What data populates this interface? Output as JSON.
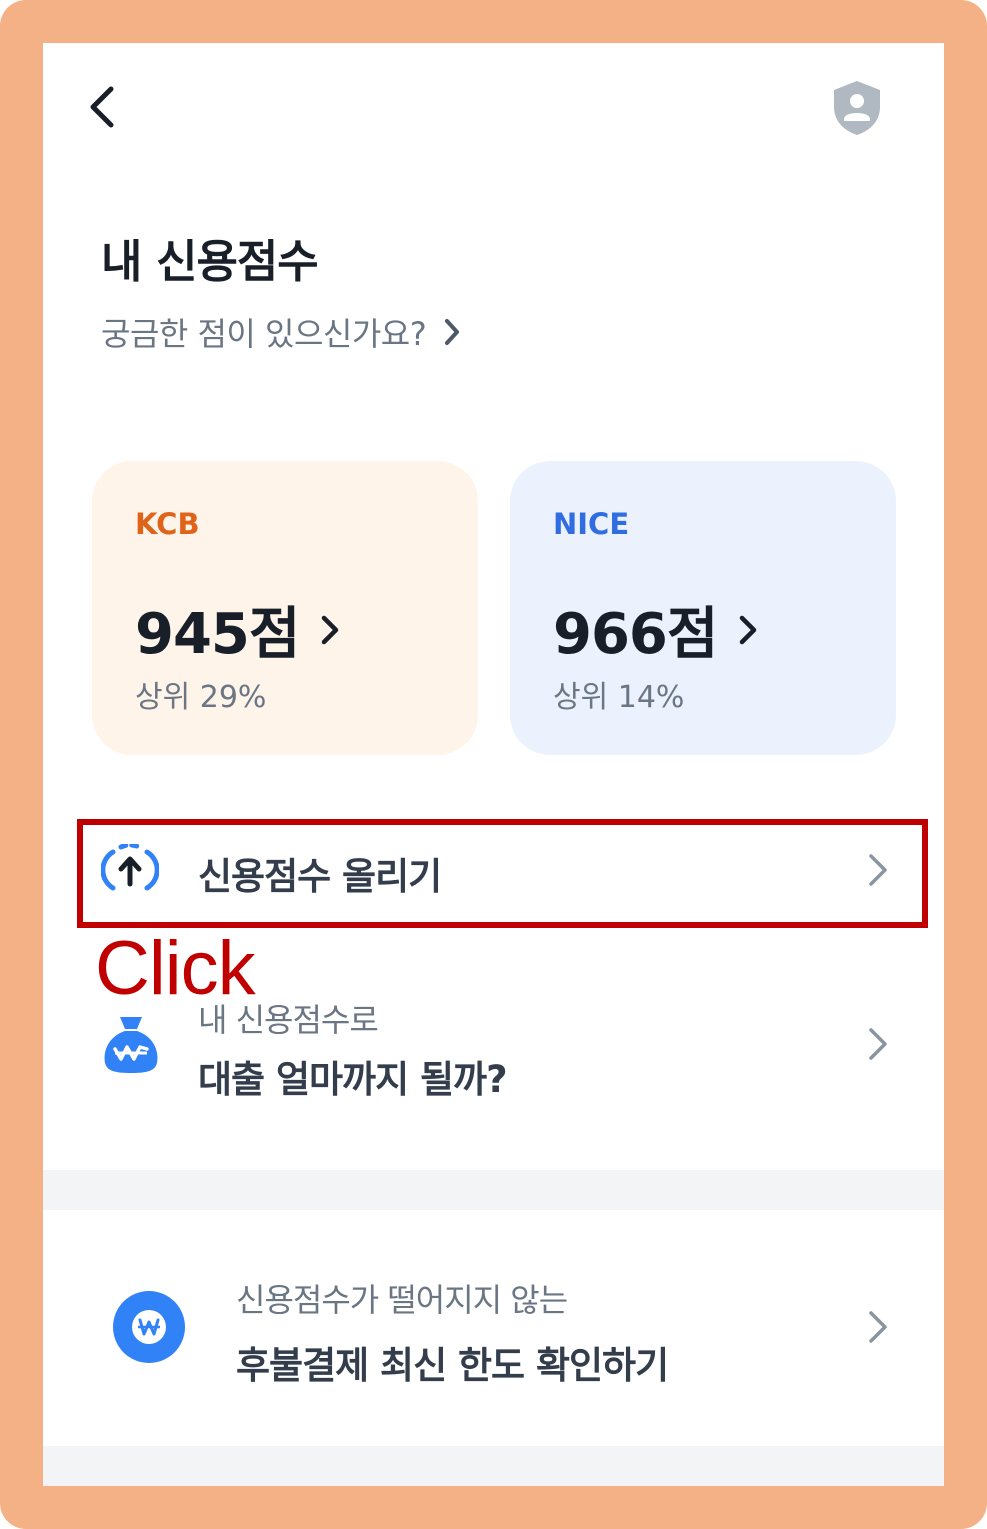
{
  "header": {
    "back_icon": "chevron-left-icon",
    "profile_icon": "shield-user-icon"
  },
  "page": {
    "title": "내 신용점수",
    "help_link": "궁금한 점이 있으신가요?"
  },
  "score_cards": [
    {
      "agency": "KCB",
      "score": "945점",
      "rank": "상위 29%",
      "accent": "#e0631a",
      "background": "#fef4e9"
    },
    {
      "agency": "NICE",
      "score": "966점",
      "rank": "상위 14%",
      "accent": "#2f6de1",
      "background": "#ebf2fe"
    }
  ],
  "menu": {
    "improve_score": {
      "label": "신용점수 올리기",
      "icon": "arrow-up-circle-icon"
    },
    "loan_limit": {
      "subtitle": "내 신용점수로",
      "title": "대출 얼마까지 될까?",
      "icon": "money-bag-icon"
    },
    "paylater": {
      "subtitle": "신용점수가 떨어지지 않는",
      "title": "후불결제 최신 한도 확인하기",
      "icon": "won-circle-icon"
    }
  },
  "annotation": {
    "label": "Click",
    "color": "#c00000"
  },
  "colors": {
    "frame": "#f3b185",
    "primary_blue": "#3182f6"
  }
}
